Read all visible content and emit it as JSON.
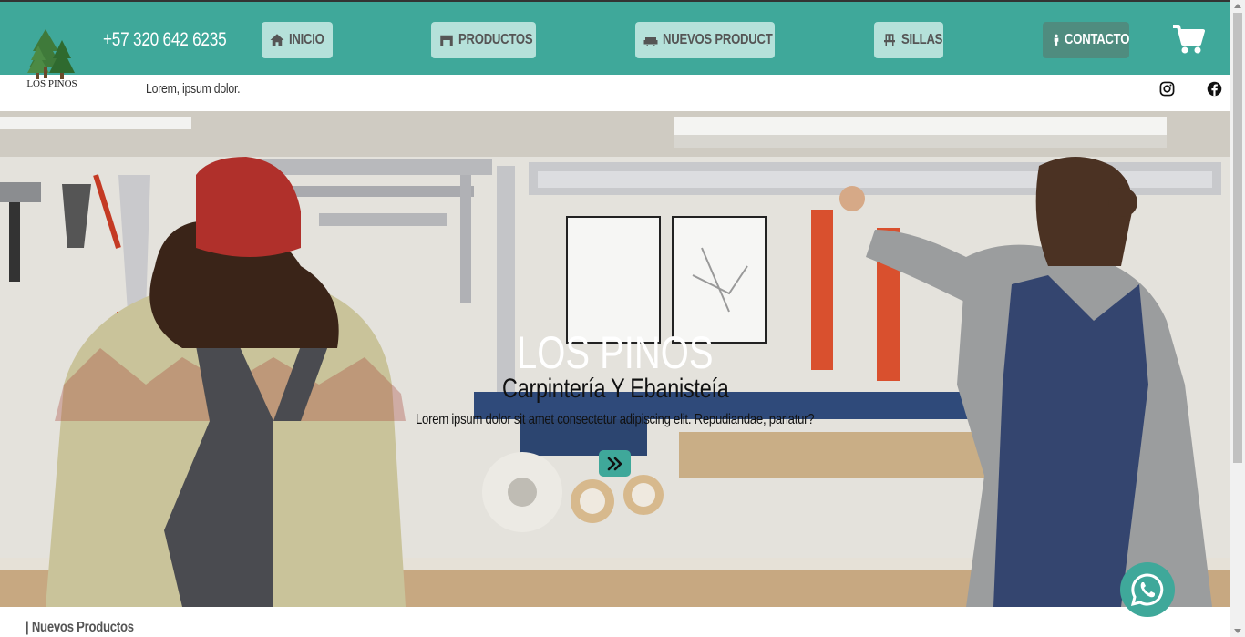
{
  "brand": {
    "name": "LOS PINOS",
    "phone": "+57 320 642 6235",
    "tagline": "Lorem, ipsum dolor.",
    "accent_color": "#3fa89a",
    "button_color": "#b5e1da",
    "contact_button_color": "#4f8c7f"
  },
  "nav": {
    "items": [
      {
        "label": "INICIO",
        "icon": "home-icon"
      },
      {
        "label": "PRODUCTOS",
        "icon": "desk-icon"
      },
      {
        "label": "NUEVOS PRODUCT",
        "icon": "sofa-icon"
      },
      {
        "label": "SILLAS",
        "icon": "chair-icon"
      },
      {
        "label": "CONTACTO",
        "icon": "person-icon"
      }
    ],
    "cart_icon": "cart-icon"
  },
  "social": {
    "instagram_icon": "instagram-icon",
    "facebook_icon": "facebook-icon"
  },
  "hero": {
    "title": "LOS PINOS",
    "subtitle": "Carpintería Y Ebanisteía",
    "description": "Lorem ipsum dolor sit amet consectetur adipiscing elit. Repudiandae, pariatur?",
    "button_icon": "double-chevron-right-icon"
  },
  "sections": {
    "new_products_title": "| Nuevos Productos"
  },
  "whatsapp_icon": "whatsapp-icon"
}
